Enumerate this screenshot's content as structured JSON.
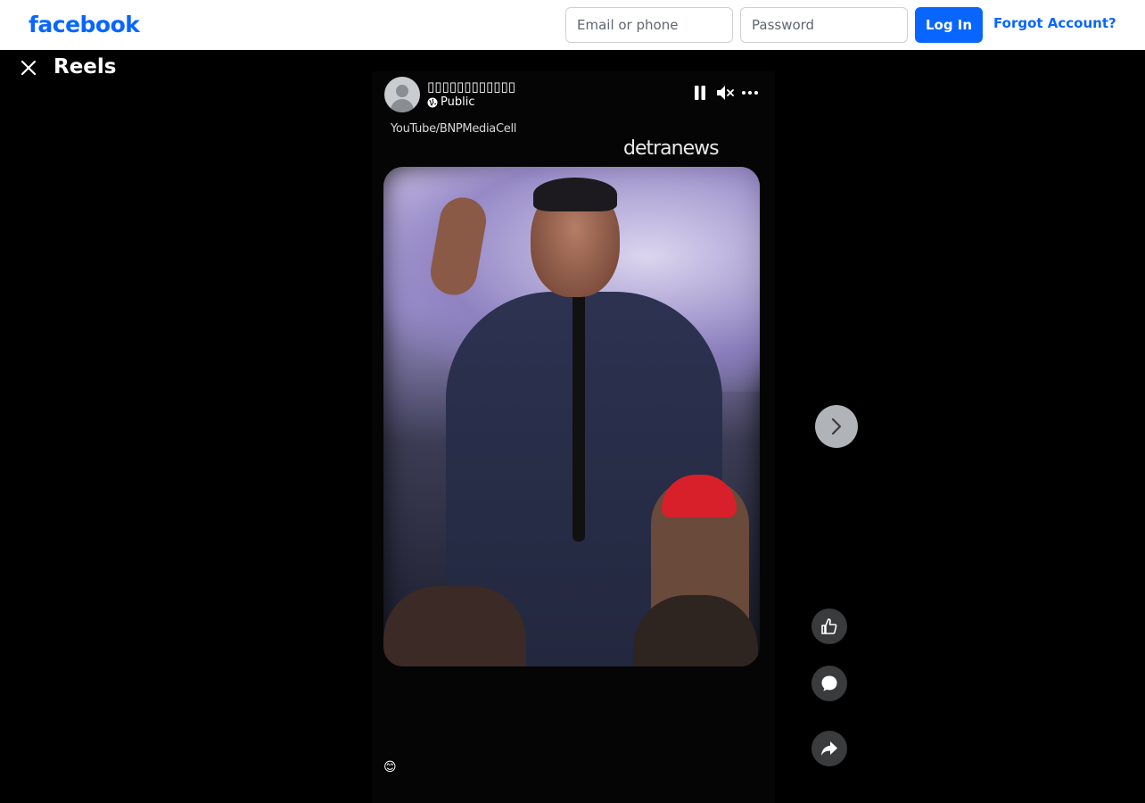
{
  "nav": {
    "logo_text": "facebook",
    "email_placeholder": "Email or phone",
    "password_placeholder": "Password",
    "login_label": "Log In",
    "forgot_label": "Forgot Account?"
  },
  "reels": {
    "title": "Reels"
  },
  "reel": {
    "author_name": "▯▯▯▯▯▯▯▯▯▯▯▯",
    "privacy": "Public",
    "watermark_source": "YouTube/BNPMediaCell",
    "watermark_brand": "detranews",
    "caption": "😊"
  },
  "icons": {
    "close": "close-icon",
    "globe": "globe-icon",
    "pause": "pause-icon",
    "mute": "mute-icon",
    "more": "more-icon",
    "next": "chevron-right-icon",
    "like": "thumbs-up-icon",
    "comment": "comment-icon",
    "share": "share-icon"
  },
  "colors": {
    "brand": "#0866ff",
    "page_background": "#000000",
    "action_button": "#3a3b3c",
    "next_button": "#b0b3b8"
  }
}
